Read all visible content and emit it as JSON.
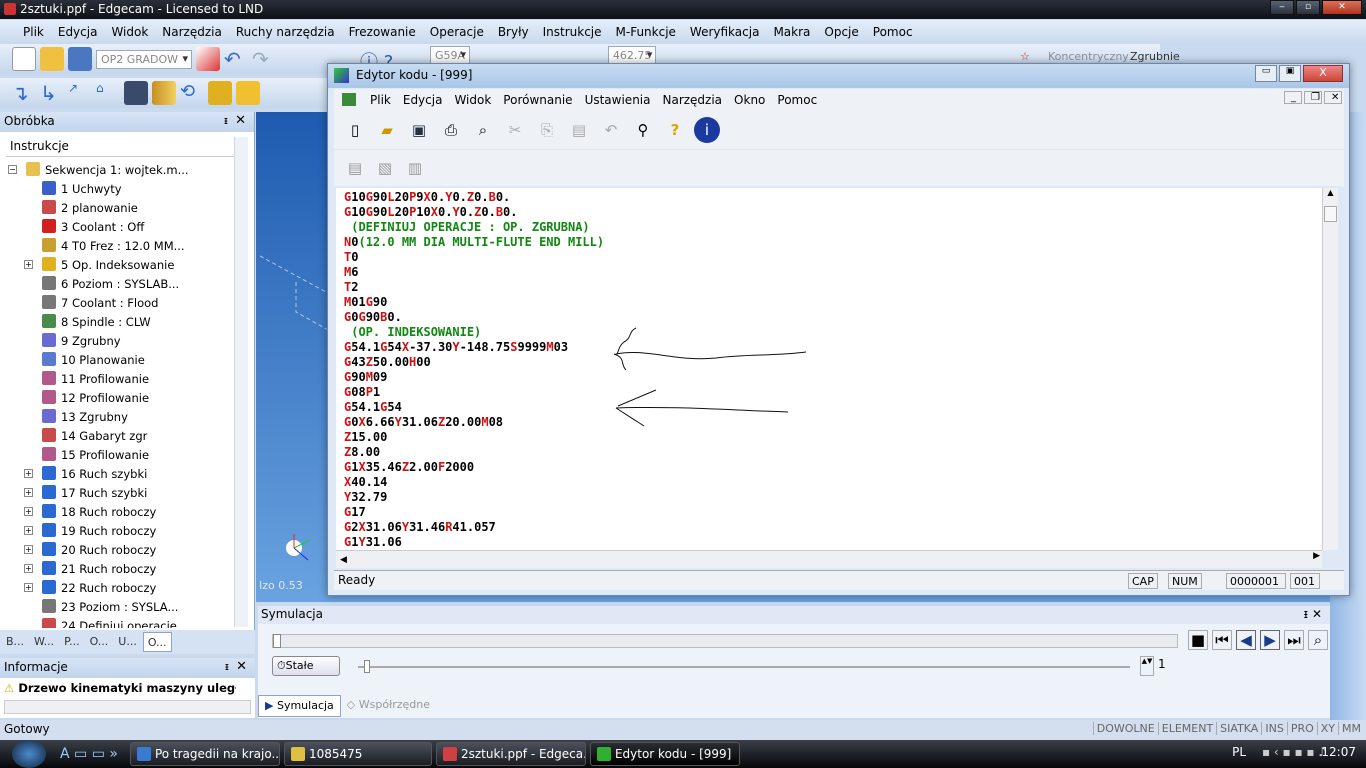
{
  "app": {
    "title": "2sztuki.ppf - Edgecam - Licensed to LND"
  },
  "menu": [
    "Plik",
    "Edycja",
    "Widok",
    "Narzędzia",
    "Ruchy narzędzia",
    "Frezowanie",
    "Operacje",
    "Bryły",
    "Instrukcje",
    "M-Funkcje",
    "Weryfikacja",
    "Makra",
    "Opcje",
    "Pomoc"
  ],
  "toolbar": {
    "combo_op": "OP2 GRADOW",
    "combo_wcs": "G59A",
    "combo_value": "462.75",
    "label_konc": "Koncentryczny",
    "label_zgrubnie": "Zgrubnie"
  },
  "panel": {
    "title": "Obróbka",
    "column": "Instrukcje",
    "root": "Sekwencja 1: wojtek.m...",
    "items": [
      {
        "label": "1 Uchwyty",
        "icon": "fixture-icon",
        "color": "#3a5fc8",
        "expand": false
      },
      {
        "label": "2 planowanie",
        "icon": "operation-icon",
        "color": "#c84a4a",
        "expand": false
      },
      {
        "label": "3 Coolant : Off",
        "icon": "coolant-off-icon",
        "color": "#d02020",
        "expand": false
      },
      {
        "label": "4 T0 Frez : 12.0 MM...",
        "icon": "tool-icon",
        "color": "#c8a030",
        "expand": false
      },
      {
        "label": "5 Op. Indeksowanie",
        "icon": "index-icon",
        "color": "#e0b020",
        "expand": true
      },
      {
        "label": "6 Poziom : SYSLAB...",
        "icon": "level-icon",
        "color": "#777777",
        "expand": false
      },
      {
        "label": "7 Coolant : Flood",
        "icon": "coolant-flood-icon",
        "color": "#777777",
        "expand": false
      },
      {
        "label": "8 Spindle : CLW",
        "icon": "spindle-icon",
        "color": "#4a8a4a",
        "expand": false
      },
      {
        "label": "9 Zgrubny",
        "icon": "roughing-icon",
        "color": "#6a6ad0",
        "expand": false
      },
      {
        "label": "10 Planowanie",
        "icon": "facing-icon",
        "color": "#5a7ad0",
        "expand": false
      },
      {
        "label": "11 Profilowanie",
        "icon": "profiling-icon",
        "color": "#b05a8a",
        "expand": false
      },
      {
        "label": "12 Profilowanie",
        "icon": "profiling-icon",
        "color": "#b05a8a",
        "expand": false
      },
      {
        "label": "13 Zgrubny",
        "icon": "roughing-icon",
        "color": "#6a6ad0",
        "expand": false
      },
      {
        "label": "14 Gabaryt zgr",
        "icon": "stock-icon",
        "color": "#c84a4a",
        "expand": false
      },
      {
        "label": "15 Profilowanie",
        "icon": "profiling-icon",
        "color": "#b05a8a",
        "expand": false
      },
      {
        "label": "16 Ruch szybki",
        "icon": "rapid-move-icon",
        "color": "#2a6ad0",
        "expand": true
      },
      {
        "label": "17 Ruch szybki",
        "icon": "rapid-move-icon",
        "color": "#2a6ad0",
        "expand": true
      },
      {
        "label": "18 Ruch roboczy",
        "icon": "feed-move-icon",
        "color": "#2a6ad0",
        "expand": true
      },
      {
        "label": "19 Ruch roboczy",
        "icon": "feed-move-icon",
        "color": "#2a6ad0",
        "expand": true
      },
      {
        "label": "20 Ruch roboczy",
        "icon": "feed-move-icon",
        "color": "#2a6ad0",
        "expand": true
      },
      {
        "label": "21 Ruch roboczy",
        "icon": "feed-move-icon",
        "color": "#2a6ad0",
        "expand": true
      },
      {
        "label": "22 Ruch roboczy",
        "icon": "feed-move-icon",
        "color": "#2a6ad0",
        "expand": true
      },
      {
        "label": "23 Poziom : SYSLA...",
        "icon": "level-icon",
        "color": "#777777",
        "expand": false
      },
      {
        "label": "24 Definiuj operacje",
        "icon": "operation-icon",
        "color": "#c84a4a",
        "expand": false
      }
    ],
    "tabs": [
      "B...",
      "W...",
      "P...",
      "O...",
      "U...",
      "O..."
    ]
  },
  "info": {
    "title": "Informacje",
    "message": "Drzewo kinematyki maszyny uległo zmian"
  },
  "status": {
    "text": "Gotowy",
    "indicators": [
      "DOWOLNE",
      "ELEMENT",
      "SIATKA",
      "INS",
      "PRO",
      "XY",
      "MM"
    ]
  },
  "viewport": {
    "zoom": "Izo 0.53"
  },
  "editor": {
    "title": "Edytor kodu - [999]",
    "menu": [
      "Plik",
      "Edycja",
      "Widok",
      "Porównanie",
      "Ustawienia",
      "Narzędzia",
      "Okno",
      "Pomoc"
    ],
    "code": [
      "G10G90L20P9X0.Y0.Z0.B0.",
      "G10G90L20P10X0.Y0.Z0.B0.",
      " (DEFINIUJ OPERACJE : OP. ZGRUBNA)",
      "N0(12.0 MM DIA MULTI-FLUTE END MILL)",
      "T0",
      "M6",
      "T2",
      "M01G90",
      "G0G90B0.",
      " (OP. INDEKSOWANIE)",
      "G54.1G54X-37.30Y-148.75S9999M03",
      "G43Z50.00H00",
      "G90M09",
      "G08P1",
      "G54.1G54",
      "G0X6.66Y31.06Z20.00M08",
      "Z15.00",
      "Z8.00",
      "G1X35.46Z2.00F2000",
      "X40.14",
      "Y32.79",
      "G17",
      "G2X31.06Y31.46R41.057",
      "G1Y31.06"
    ],
    "colors": {
      "address": "#d01010",
      "comment": "#118811"
    },
    "status": {
      "text": "Ready",
      "cap": "CAP",
      "num": "NUM",
      "line": "0000001",
      "col": "001"
    }
  },
  "simulation": {
    "title": "Symulacja",
    "speed_button": "Stałe",
    "step_value": "1",
    "tabs": [
      "Symulacja",
      "Współrzędne"
    ],
    "progress": 0
  },
  "taskbar": {
    "items": [
      "Po tragedii na krajo...",
      "1085475",
      "2sztuki.ppf - Edgeca...",
      "Edytor kodu - [999]"
    ],
    "lang": "PL",
    "clock": "12:07"
  }
}
